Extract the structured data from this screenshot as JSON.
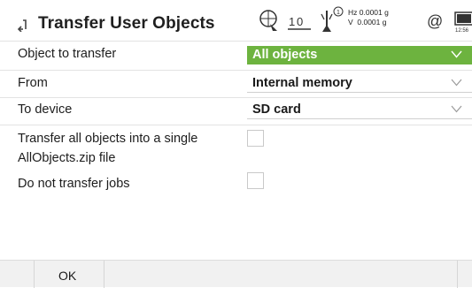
{
  "header": {
    "title": "Transfer User Objects",
    "status": {
      "prism_const": "1.0",
      "hz_accuracy": "Hz 0.0001 g",
      "v_accuracy": "V  0.0001 g",
      "at_symbol": "@",
      "time": "12:56"
    }
  },
  "form": {
    "object_to_transfer": {
      "label": "Object to transfer",
      "value": "All objects"
    },
    "from": {
      "label": "From",
      "value": "Internal memory"
    },
    "to_device": {
      "label": "To device",
      "value": "SD card"
    },
    "single_zip": {
      "label_line1": "Transfer all objects into a single",
      "label_line2": "AllObjects.zip file",
      "checked": false
    },
    "no_jobs": {
      "label": "Do not transfer jobs",
      "checked": false
    }
  },
  "softkeys": {
    "ok_label": "OK"
  },
  "colors": {
    "selected_field": "#6db33f",
    "accent_text": "#ffffff"
  }
}
